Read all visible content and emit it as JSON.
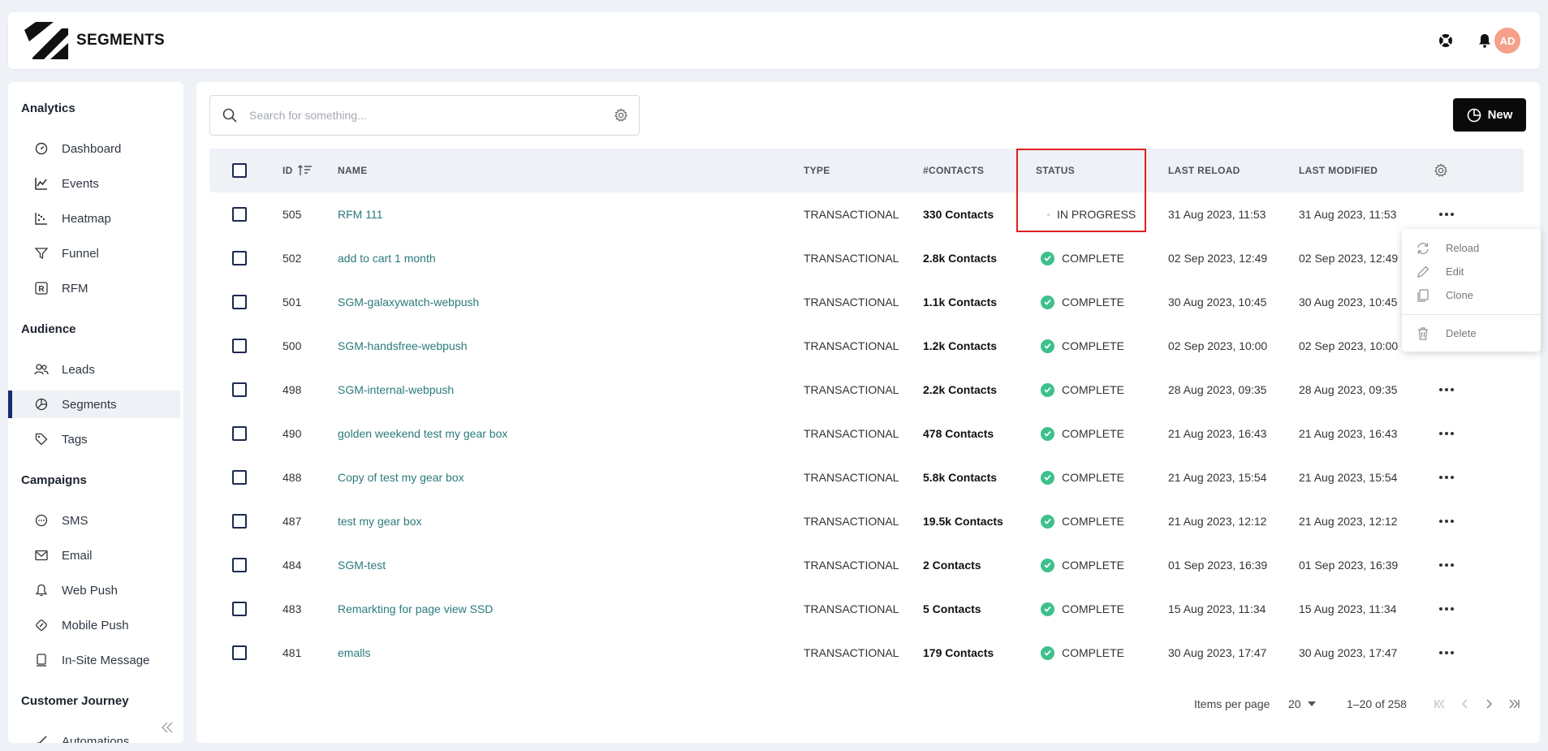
{
  "header": {
    "title": "SEGMENTS",
    "avatar_initials": "AD"
  },
  "sidebar": {
    "sections": [
      {
        "label": "Analytics",
        "items": [
          {
            "label": "Dashboard",
            "icon": "gauge-icon"
          },
          {
            "label": "Events",
            "icon": "line-chart-icon"
          },
          {
            "label": "Heatmap",
            "icon": "scatter-icon"
          },
          {
            "label": "Funnel",
            "icon": "funnel-icon"
          },
          {
            "label": "RFM",
            "icon": "rfm-icon"
          }
        ]
      },
      {
        "label": "Audience",
        "items": [
          {
            "label": "Leads",
            "icon": "users-icon"
          },
          {
            "label": "Segments",
            "icon": "pie-icon"
          },
          {
            "label": "Tags",
            "icon": "tag-icon"
          }
        ]
      },
      {
        "label": "Campaigns",
        "items": [
          {
            "label": "SMS",
            "icon": "sms-icon"
          },
          {
            "label": "Email",
            "icon": "mail-icon"
          },
          {
            "label": "Web Push",
            "icon": "bell-icon"
          },
          {
            "label": "Mobile Push",
            "icon": "mobile-push-icon"
          },
          {
            "label": "In-Site Message",
            "icon": "insite-icon"
          }
        ]
      },
      {
        "label": "Customer Journey",
        "items": [
          {
            "label": "Automations",
            "icon": "automation-icon"
          }
        ]
      }
    ]
  },
  "search": {
    "placeholder": "Search for something..."
  },
  "toolbar": {
    "new_label": "New"
  },
  "table": {
    "columns": {
      "id": "ID",
      "name": "NAME",
      "type": "TYPE",
      "contacts": "#CONTACTS",
      "status": "STATUS",
      "last_reload": "LAST RELOAD",
      "last_modified": "LAST MODIFIED"
    },
    "rows": [
      {
        "id": "505",
        "name": "RFM 111",
        "type": "TRANSACTIONAL",
        "contacts": "330 Contacts",
        "status": "IN PROGRESS",
        "last_reload": "31 Aug 2023, 11:53",
        "last_modified": "31 Aug 2023, 11:53"
      },
      {
        "id": "502",
        "name": "add to cart 1 month",
        "type": "TRANSACTIONAL",
        "contacts": "2.8k Contacts",
        "status": "COMPLETE",
        "last_reload": "02 Sep 2023, 12:49",
        "last_modified": "02 Sep 2023, 12:49"
      },
      {
        "id": "501",
        "name": "SGM-galaxywatch-webpush",
        "type": "TRANSACTIONAL",
        "contacts": "1.1k Contacts",
        "status": "COMPLETE",
        "last_reload": "30 Aug 2023, 10:45",
        "last_modified": "30 Aug 2023, 10:45"
      },
      {
        "id": "500",
        "name": "SGM-handsfree-webpush",
        "type": "TRANSACTIONAL",
        "contacts": "1.2k Contacts",
        "status": "COMPLETE",
        "last_reload": "02 Sep 2023, 10:00",
        "last_modified": "02 Sep 2023, 10:00"
      },
      {
        "id": "498",
        "name": "SGM-internal-webpush",
        "type": "TRANSACTIONAL",
        "contacts": "2.2k Contacts",
        "status": "COMPLETE",
        "last_reload": "28 Aug 2023, 09:35",
        "last_modified": "28 Aug 2023, 09:35"
      },
      {
        "id": "490",
        "name": "golden weekend test my gear box",
        "type": "TRANSACTIONAL",
        "contacts": "478 Contacts",
        "status": "COMPLETE",
        "last_reload": "21 Aug 2023, 16:43",
        "last_modified": "21 Aug 2023, 16:43"
      },
      {
        "id": "488",
        "name": "Copy of test my gear box",
        "type": "TRANSACTIONAL",
        "contacts": "5.8k Contacts",
        "status": "COMPLETE",
        "last_reload": "21 Aug 2023, 15:54",
        "last_modified": "21 Aug 2023, 15:54"
      },
      {
        "id": "487",
        "name": "test my gear box",
        "type": "TRANSACTIONAL",
        "contacts": "19.5k Contacts",
        "status": "COMPLETE",
        "last_reload": "21 Aug 2023, 12:12",
        "last_modified": "21 Aug 2023, 12:12"
      },
      {
        "id": "484",
        "name": "SGM-test",
        "type": "TRANSACTIONAL",
        "contacts": "2 Contacts",
        "status": "COMPLETE",
        "last_reload": "01 Sep 2023, 16:39",
        "last_modified": "01 Sep 2023, 16:39"
      },
      {
        "id": "483",
        "name": "Remarkting for page view SSD",
        "type": "TRANSACTIONAL",
        "contacts": "5 Contacts",
        "status": "COMPLETE",
        "last_reload": "15 Aug 2023, 11:34",
        "last_modified": "15 Aug 2023, 11:34"
      },
      {
        "id": "481",
        "name": "emalls",
        "type": "TRANSACTIONAL",
        "contacts": "179 Contacts",
        "status": "COMPLETE",
        "last_reload": "30 Aug 2023, 17:47",
        "last_modified": "30 Aug 2023, 17:47"
      }
    ]
  },
  "context_menu": {
    "items": [
      {
        "label": "Reload",
        "icon": "reload-icon"
      },
      {
        "label": "Edit",
        "icon": "pencil-icon"
      },
      {
        "label": "Clone",
        "icon": "copy-icon"
      },
      {
        "label": "Delete",
        "icon": "trash-icon"
      }
    ]
  },
  "pagination": {
    "items_per_page_label": "Items per page",
    "page_size": "20",
    "range": "1–20 of 258"
  },
  "colors": {
    "accent": "#1a2b6d",
    "link": "#2b7a7b",
    "complete": "#3ec08d",
    "highlight": "#e0201f",
    "avatar": "#f4a08b"
  }
}
